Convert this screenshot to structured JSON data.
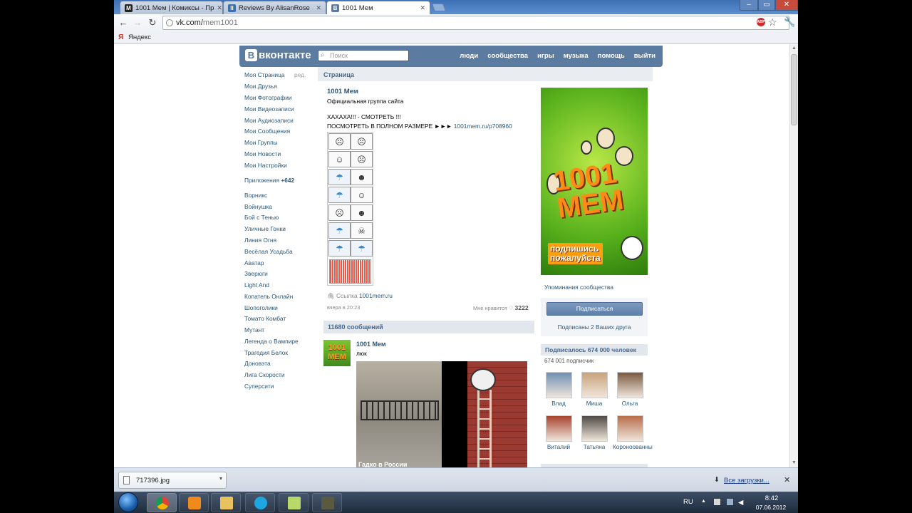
{
  "browser": {
    "tabs": [
      {
        "favicon": "M",
        "title": "1001 Мем | Комиксы - Пр"
      },
      {
        "favicon": "II",
        "title": "Reviews By AlisanRose"
      },
      {
        "favicon": "B",
        "title": "1001 Мем"
      }
    ],
    "url_host": "vk.com/",
    "url_path": "mem1001",
    "bookmark": "Яндекс",
    "abp_label": "ABP"
  },
  "vk": {
    "logo": "вконтакте",
    "search_placeholder": "Поиск",
    "nav": [
      "люди",
      "сообщества",
      "игры",
      "музыка",
      "помощь",
      "выйти"
    ],
    "menu": [
      {
        "label": "Моя Страница",
        "extra": "ред."
      },
      {
        "label": "Мои Друзья"
      },
      {
        "label": "Мои Фотографии"
      },
      {
        "label": "Мои Видеозаписи"
      },
      {
        "label": "Мои Аудиозаписи"
      },
      {
        "label": "Мои Сообщения"
      },
      {
        "label": "Мои Группы"
      },
      {
        "label": "Мои Новости"
      },
      {
        "label": "Мои Настройки"
      }
    ],
    "apps_label": "Приложения",
    "apps_count": "+642",
    "apps": [
      "Ворникс",
      "Войнушка",
      "Бой с Тенью",
      "Уличные Гонки",
      "Линия Огня",
      "Весёлая Усадьба",
      "Аватар",
      "Зверюги",
      "Light And",
      "Копатель Онлайн",
      "Шопоголики",
      "Томато Комбат",
      "Мутант",
      "Легенда о Вампире",
      "Трагедия Белок",
      "Доновэта",
      "Лига Скорости",
      "Суперсити"
    ]
  },
  "center": {
    "header": "Страница",
    "group_name": "1001 Мем",
    "group_desc": "Официальная группа сайта",
    "post_line1": "ХАХАХА!!! - СМОТРЕТЬ !!!",
    "post_line2": "ПОСМОТРЕТЬ В ПОЛНОМ РАЗМЕРЕ ►►►",
    "post_link": "1001mem.ru/p708960",
    "link_label": "Ссылка",
    "link_url": "1001mem.ru",
    "post_time": "вчера в 20:23",
    "likes_label": "Мне нравится",
    "likes_count": "3222",
    "posts_count": "11680 сообщений",
    "post2_author": "1001 Мем",
    "post2_text": "люк",
    "photo_caption": "Гадко в России",
    "avatar_text": "1001 МЕМ"
  },
  "right": {
    "banner_title": "1001 МЕМ",
    "banner_sub1": "подпишись",
    "banner_sub2": "пожалуйста",
    "mentions": "Упоминания сообщества",
    "subscribe_btn": "Подписаться",
    "subscribed_friends": "Подписаны 2 Ваших друга",
    "subscribers_header": "Подписалось 674 000 человек",
    "subscribers_count": "674 001 подписчик",
    "friends": [
      {
        "name": "Влад",
        "color": "#6f8fb3"
      },
      {
        "name": "Миша",
        "color": "#c9a27a"
      },
      {
        "name": "Ольга",
        "color": "#7a5a40"
      },
      {
        "name": "Виталий",
        "color": "#a8442f"
      },
      {
        "name": "Татьяна",
        "color": "#4f4a45"
      },
      {
        "name": "Короноованны",
        "color": "#b86d4a"
      }
    ]
  },
  "downloads": {
    "file": "717396.jpg",
    "all": "Все загрузки..."
  },
  "taskbar": {
    "lang": "RU",
    "time": "8:42",
    "date": "07.06.2012"
  },
  "colors": {
    "vk_header": "#5b7ba1",
    "vk_link": "#2b587a",
    "vk_bar": "#e1e7ed"
  }
}
